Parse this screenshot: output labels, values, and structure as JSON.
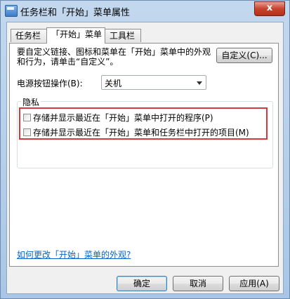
{
  "window": {
    "title": "任务栏和「开始」菜单属性",
    "close_glyph": "x"
  },
  "tabs": [
    {
      "label": "任务栏",
      "active": false
    },
    {
      "label": "「开始」菜单",
      "active": true
    },
    {
      "label": "工具栏",
      "active": false
    }
  ],
  "start_menu": {
    "description": "要自定义链接、图标和菜单在「开始」菜单中的外观和行为，请单击“自定义”。",
    "customize_button": "自定义(C)...",
    "power_label": "电源按钮操作(B):",
    "power_value": "关机",
    "privacy_group_title": "隐私",
    "check_programs_label": "存储并显示最近在「开始」菜单中打开的程序(P)",
    "check_programs_checked": false,
    "check_items_label": "存储并显示最近在「开始」菜单和任务栏中打开的项目(M)",
    "check_items_checked": false,
    "help_link": "如何更改「开始」菜单的外观?"
  },
  "footer": {
    "ok_label": "确定",
    "cancel_label": "取消",
    "apply_label": "应用(A)"
  },
  "colors": {
    "highlight_box": "#d63a3a",
    "link": "#0066cc"
  }
}
